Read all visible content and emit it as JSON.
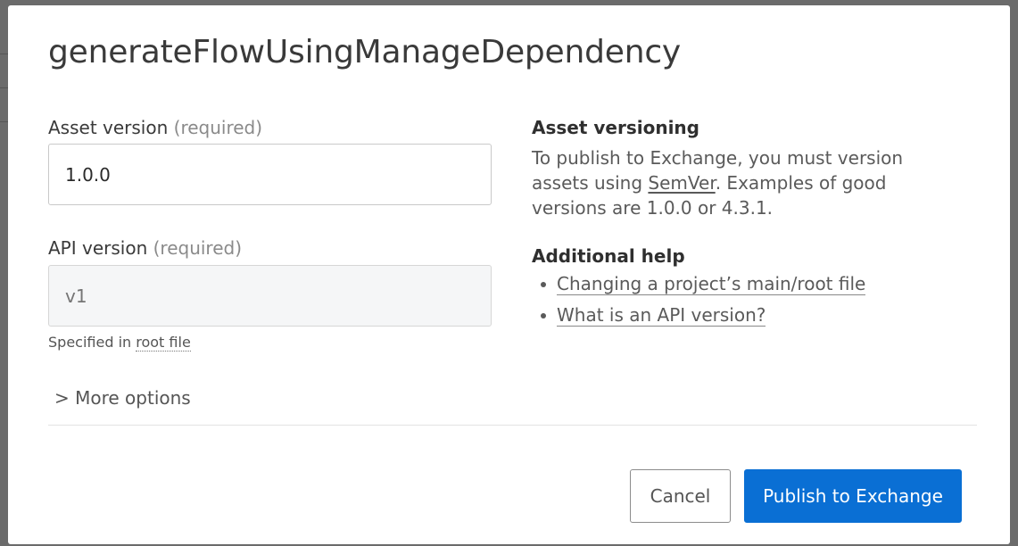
{
  "dialog": {
    "title": "generateFlowUsingManageDependency"
  },
  "form": {
    "asset_version": {
      "label": "Asset version",
      "required_text": "(required)",
      "value": "1.0.0"
    },
    "api_version": {
      "label": "API version",
      "required_text": "(required)",
      "placeholder": "v1",
      "helper_prefix": "Specified in",
      "helper_link": "root file"
    },
    "more_options": "> More options"
  },
  "side": {
    "versioning_heading": "Asset versioning",
    "versioning_text_before": "To publish to Exchange, you must version assets using",
    "versioning_link": "SemVer",
    "versioning_text_after": ". Examples of good versions are 1.0.0 or 4.3.1.",
    "help_heading": "Additional help",
    "help_links": [
      "Changing a project’s main/root file",
      "What is an API version?"
    ]
  },
  "actions": {
    "cancel_label": "Cancel",
    "publish_label": "Publish to Exchange"
  },
  "colors": {
    "primary": "#0a6fd4",
    "overlay": "#5c5c5c"
  }
}
